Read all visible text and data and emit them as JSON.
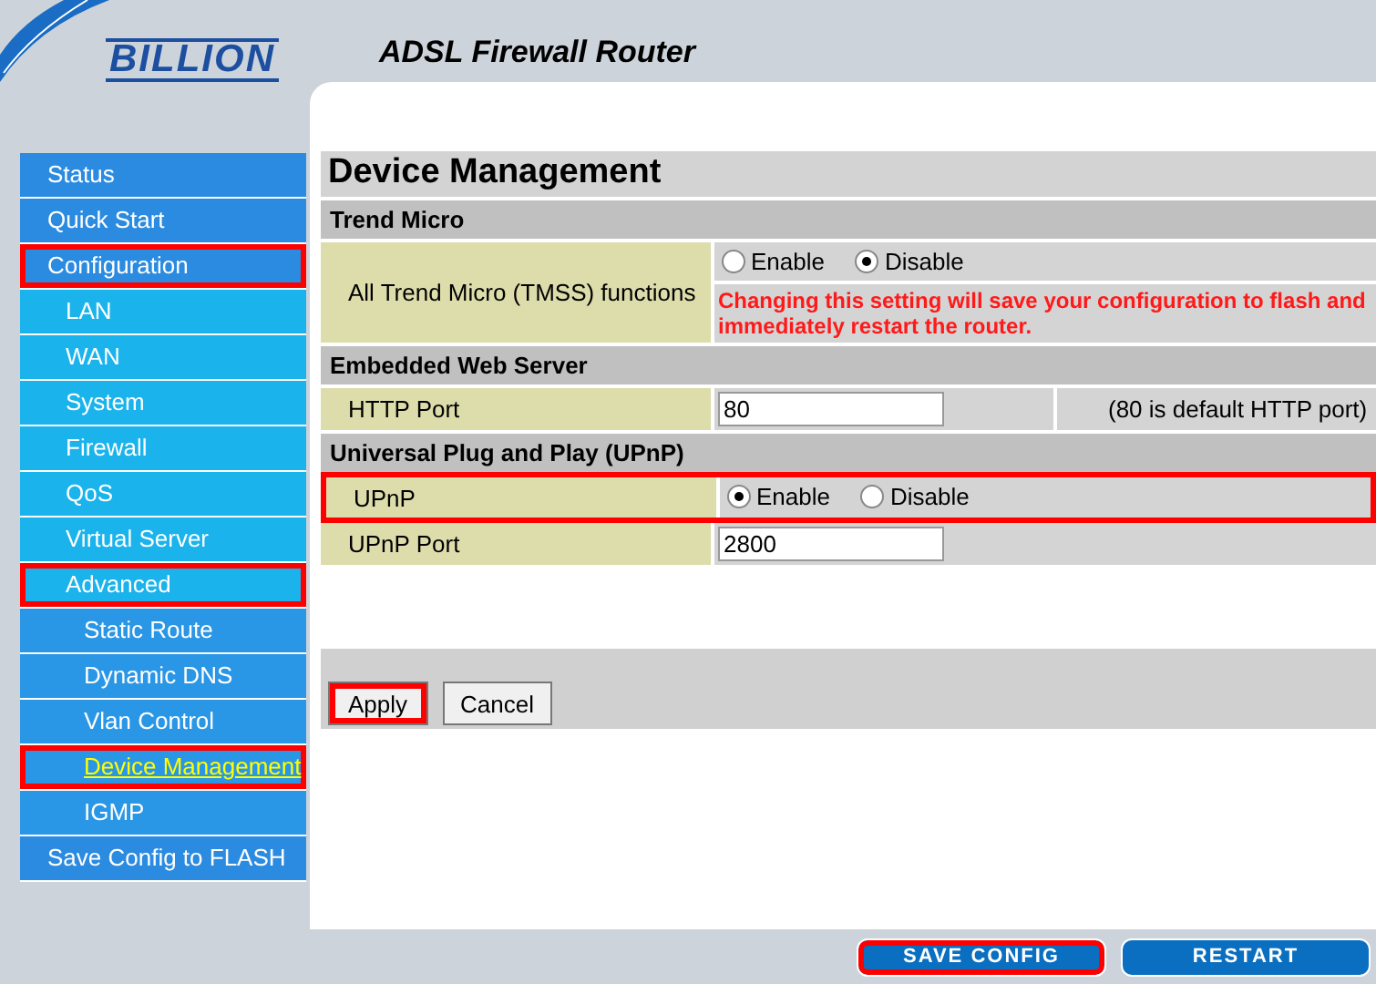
{
  "header": {
    "logo": "BILLION",
    "title": "ADSL Firewall Router"
  },
  "nav": [
    {
      "label": "Status",
      "selected": false,
      "highlighted": false
    },
    {
      "label": "Quick Start",
      "selected": false,
      "highlighted": false
    },
    {
      "label": "Configuration",
      "selected": false,
      "highlighted": true,
      "children": [
        {
          "label": "LAN",
          "selected": false,
          "highlighted": false
        },
        {
          "label": "WAN",
          "selected": false,
          "highlighted": false
        },
        {
          "label": "System",
          "selected": false,
          "highlighted": false
        },
        {
          "label": "Firewall",
          "selected": false,
          "highlighted": false
        },
        {
          "label": "QoS",
          "selected": false,
          "highlighted": false
        },
        {
          "label": "Virtual Server",
          "selected": false,
          "highlighted": false
        },
        {
          "label": "Advanced",
          "selected": false,
          "highlighted": true,
          "children": [
            {
              "label": "Static Route",
              "selected": false,
              "highlighted": false
            },
            {
              "label": "Dynamic DNS",
              "selected": false,
              "highlighted": false
            },
            {
              "label": "Vlan Control",
              "selected": false,
              "highlighted": false
            },
            {
              "label": "Device Management",
              "selected": true,
              "highlighted": true
            },
            {
              "label": "IGMP",
              "selected": false,
              "highlighted": false
            }
          ]
        }
      ]
    },
    {
      "label": "Save Config to FLASH",
      "selected": false,
      "highlighted": false
    }
  ],
  "page": {
    "title": "Device Management",
    "sections": [
      {
        "title": "Trend Micro",
        "rows": [
          {
            "kind": "radio",
            "label": "All Trend Micro (TMSS) functions",
            "highlighted": false,
            "options": [
              {
                "label": "Enable",
                "selected": false
              },
              {
                "label": "Disable",
                "selected": true
              }
            ],
            "warning": "Changing this setting will save your configuration to flash and immediately restart the router."
          }
        ]
      },
      {
        "title": "Embedded Web Server",
        "rows": [
          {
            "kind": "input",
            "label": "HTTP Port",
            "highlighted": false,
            "value": "80",
            "note": "(80 is default HTTP port)"
          }
        ]
      },
      {
        "title": "Universal Plug and Play (UPnP)",
        "rows": [
          {
            "kind": "radio",
            "label": "UPnP",
            "highlighted": true,
            "options": [
              {
                "label": "Enable",
                "selected": true
              },
              {
                "label": "Disable",
                "selected": false
              }
            ]
          },
          {
            "kind": "input",
            "label": "UPnP Port",
            "highlighted": false,
            "value": "2800"
          }
        ]
      }
    ]
  },
  "actions": [
    {
      "label": "Apply",
      "highlighted": true
    },
    {
      "label": "Cancel",
      "highlighted": false
    }
  ],
  "footer_buttons": [
    {
      "label": "SAVE CONFIG",
      "highlighted": true
    },
    {
      "label": "RESTART",
      "highlighted": false
    }
  ]
}
